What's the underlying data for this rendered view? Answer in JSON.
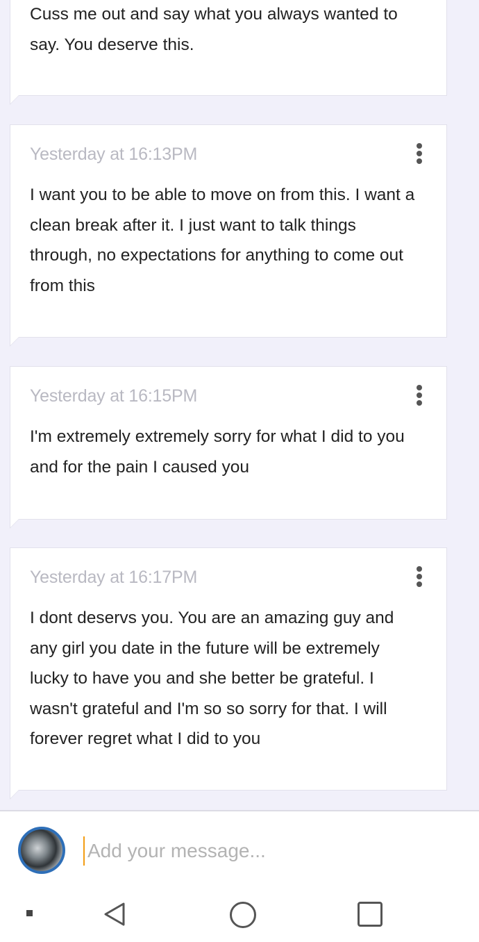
{
  "messages": [
    {
      "timestamp": "",
      "text": "Cuss me out and say what you always wanted to say. You deserve this."
    },
    {
      "timestamp": "Yesterday at 16:13PM",
      "text": "I want you to be able to move on from this. I want a clean break after it. I just want to talk things through, no expectations for anything to come out from this"
    },
    {
      "timestamp": "Yesterday at 16:15PM",
      "text": "I'm extremely extremely sorry for what I did to you and for the pain I caused you"
    },
    {
      "timestamp": "Yesterday at 16:17PM",
      "text": "I dont deservs you. You are an amazing guy and any girl you date in the future will be extremely lucky to have you and she better be grateful. I wasn't grateful and I'm so so sorry for that. I will forever regret what I did to you"
    }
  ],
  "composer": {
    "placeholder": "Add your message..."
  },
  "icons": {
    "message_menu": "more-vertical-icon",
    "nav_menu": "menu-dot-icon",
    "nav_back": "back-triangle-icon",
    "nav_home": "home-circle-icon",
    "nav_recents": "recents-square-icon"
  },
  "colors": {
    "background": "#f1f0fa",
    "card": "#ffffff",
    "timestamp": "#b9b9c2",
    "text": "#222222",
    "cursor": "#f39c12",
    "avatar_ring": "#2e6fb8"
  }
}
